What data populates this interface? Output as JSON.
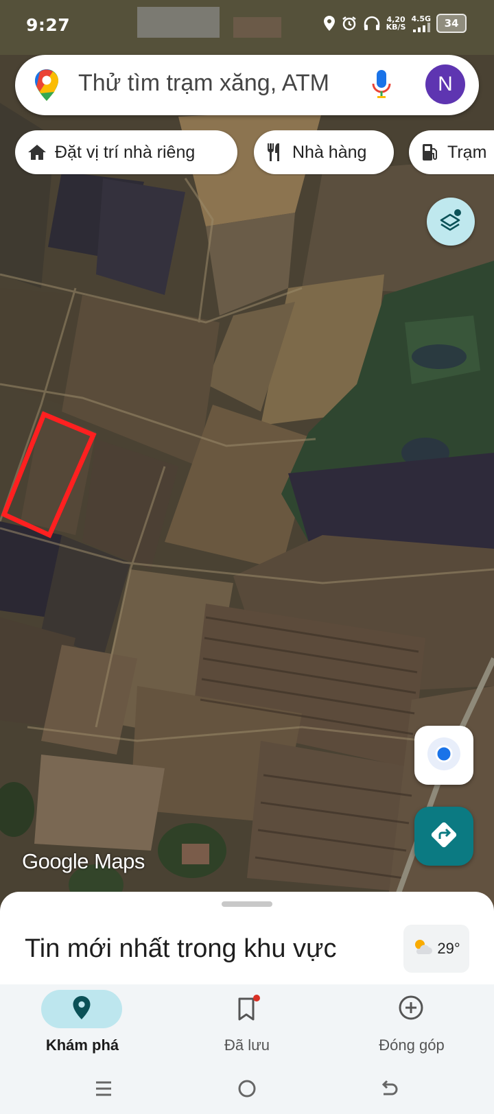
{
  "status_bar": {
    "time": "9:27",
    "net_speed_value": "4,20",
    "net_speed_unit": "KB/S",
    "network": "4.5G",
    "battery": "34",
    "icons": [
      "location-icon",
      "alarm-icon",
      "headset-icon",
      "signal-icon",
      "battery-icon"
    ]
  },
  "search": {
    "placeholder": "Thử tìm trạm xăng, ATM",
    "avatar_letter": "N",
    "avatar_color": "#5e35b1"
  },
  "chips": [
    {
      "label": "Đặt vị trí nhà riêng",
      "icon": "home-icon"
    },
    {
      "label": "Nhà hàng",
      "icon": "restaurant-icon"
    },
    {
      "label": "Trạm",
      "icon": "gas-station-icon"
    }
  ],
  "map": {
    "watermark": "Google Maps",
    "highlight_color": "#ff2020"
  },
  "sheet": {
    "news_title": "Tin mới nhất trong khu vực",
    "temperature": "29°",
    "weather_icon": "partly-sunny-icon"
  },
  "nav": {
    "tabs": [
      {
        "label": "Khám phá",
        "icon": "explore-pin-icon",
        "active": true
      },
      {
        "label": "Đã lưu",
        "icon": "bookmark-icon",
        "active": false,
        "badge": true
      },
      {
        "label": "Đóng góp",
        "icon": "add-circle-icon",
        "active": false
      }
    ]
  },
  "colors": {
    "accent": "#0b7a82",
    "active_tab_bg": "#bde6ee",
    "location_dot": "#1a73e8"
  }
}
